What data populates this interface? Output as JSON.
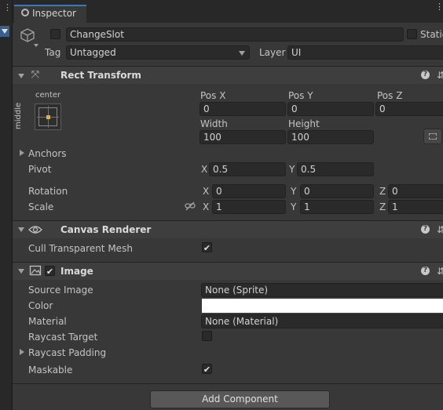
{
  "tab": {
    "title": "Inspector"
  },
  "object": {
    "name": "ChangeSlot",
    "static_label": "Static",
    "tag_label": "Tag",
    "tag_value": "Untagged",
    "layer_label": "Layer",
    "layer_value": "UI"
  },
  "rect_transform": {
    "title": "Rect Transform",
    "anchor_preset_h": "center",
    "anchor_preset_v": "middle",
    "pos_x_label": "Pos X",
    "pos_x": "0",
    "pos_y_label": "Pos Y",
    "pos_y": "0",
    "pos_z_label": "Pos Z",
    "pos_z": "0",
    "width_label": "Width",
    "width": "100",
    "height_label": "Height",
    "height": "100",
    "anchors_label": "Anchors",
    "pivot_label": "Pivot",
    "pivot_x": "0.5",
    "pivot_y": "0.5",
    "rotation_label": "Rotation",
    "rot_x": "0",
    "rot_y": "0",
    "rot_z": "0",
    "scale_label": "Scale",
    "scale_x": "1",
    "scale_y": "1",
    "scale_z": "1",
    "axis_x": "X",
    "axis_y": "Y",
    "axis_z": "Z"
  },
  "canvas_renderer": {
    "title": "Canvas Renderer",
    "cull_label": "Cull Transparent Mesh",
    "cull_checked": true
  },
  "image": {
    "title": "Image",
    "source_image_label": "Source Image",
    "source_image": "None (Sprite)",
    "color_label": "Color",
    "color_value": "#ffffff",
    "material_label": "Material",
    "material": "None (Material)",
    "raycast_target_label": "Raycast Target",
    "raycast_padding_label": "Raycast Padding",
    "maskable_label": "Maskable"
  },
  "add_component_label": "Add Component",
  "help_glyph": "?",
  "check_glyph": "✔",
  "colors": {
    "accent": "#3a79bb",
    "panel": "#383838",
    "field": "#2a2a2a"
  }
}
